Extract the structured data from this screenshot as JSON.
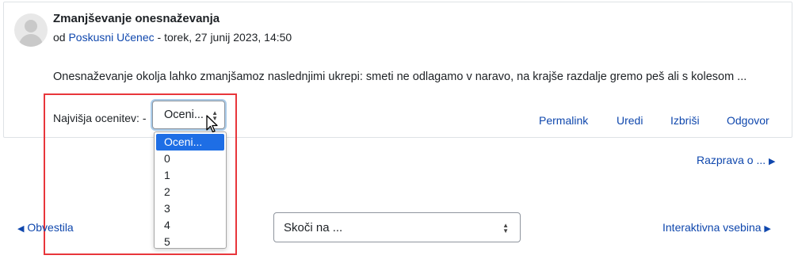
{
  "post": {
    "subject": "Zmanjševanje onesnaževanja",
    "by_prefix": "od",
    "author": "Poskusni Učenec",
    "date": " - torek, 27 junij 2023, 14:50",
    "message": "Onesnaževanje okolja lahko zmanjšamoz naslednjimi ukrepi: smeti ne odlagamo v naravo, na krajše razdalje gremo peš ali s kolesom ..."
  },
  "rating": {
    "label": "Najvišja ocenitev: -",
    "selected": "Oceni...",
    "options": [
      "Oceni...",
      "0",
      "1",
      "2",
      "3",
      "4",
      "5"
    ]
  },
  "actions": {
    "permalink": "Permalink",
    "edit": "Uredi",
    "delete": "Izbriši",
    "reply": "Odgovor"
  },
  "navigation": {
    "discussion": "Razprava o ...",
    "prev": "Obvestila",
    "jump_placeholder": "Skoči na ...",
    "next": "Interaktivna vsebina"
  },
  "colors": {
    "link": "#0f47ad",
    "highlight": "#e8363b",
    "option_selected": "#1e6ee5"
  }
}
